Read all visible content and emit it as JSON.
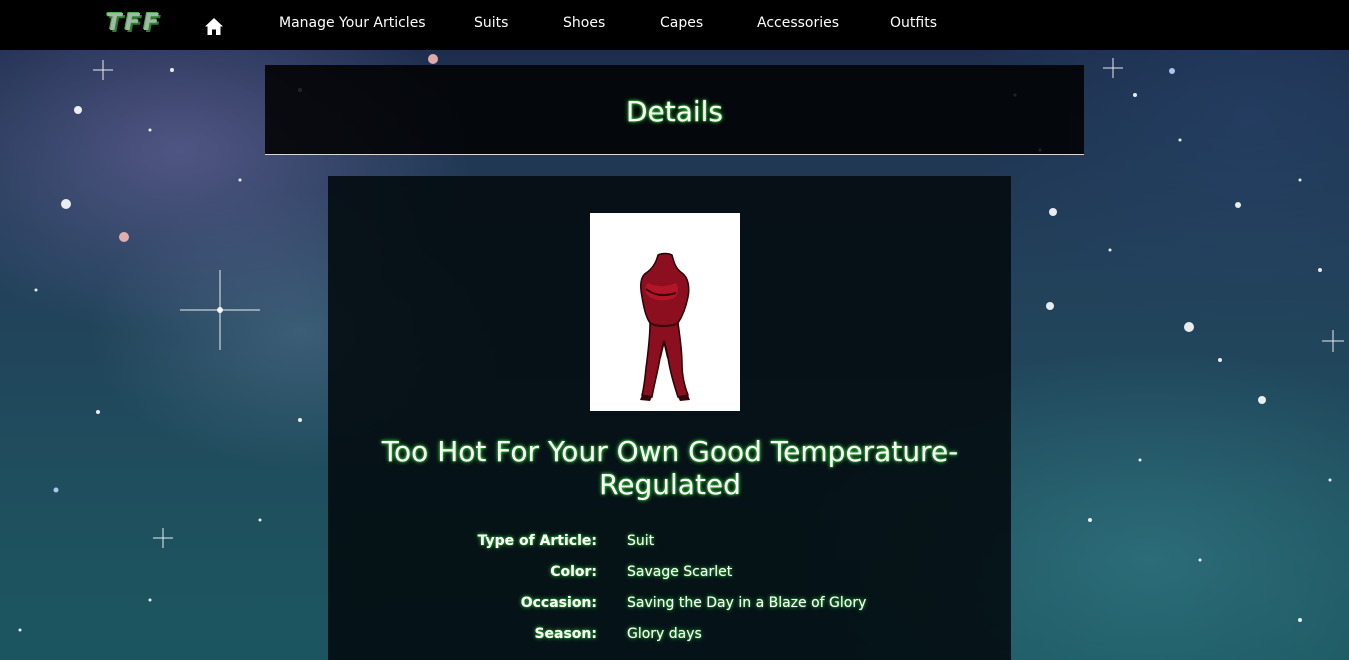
{
  "navbar": {
    "brand": "TFF",
    "home_icon": "home-icon",
    "items": [
      {
        "label": "Manage Your Articles"
      },
      {
        "label": "Suits"
      },
      {
        "label": "Shoes"
      },
      {
        "label": "Capes"
      },
      {
        "label": "Accessories"
      },
      {
        "label": "Outfits"
      }
    ]
  },
  "page": {
    "title": "Details"
  },
  "article": {
    "name": "Too Hot For Your Own Good Temperature-Regulated",
    "image_icon": "red-suit-figure",
    "properties": [
      {
        "label": "Type of Article:",
        "value": "Suit"
      },
      {
        "label": "Color:",
        "value": "Savage Scarlet"
      },
      {
        "label": "Occasion:",
        "value": "Saving the Day in a Blaze of Glory"
      },
      {
        "label": "Season:",
        "value": "Glory days"
      }
    ]
  },
  "colors": {
    "navbar_bg": "#000000",
    "text_glow": "#3fd23f",
    "brand_green": "#2f7d2f",
    "suit_red": "#8b0f1f"
  }
}
